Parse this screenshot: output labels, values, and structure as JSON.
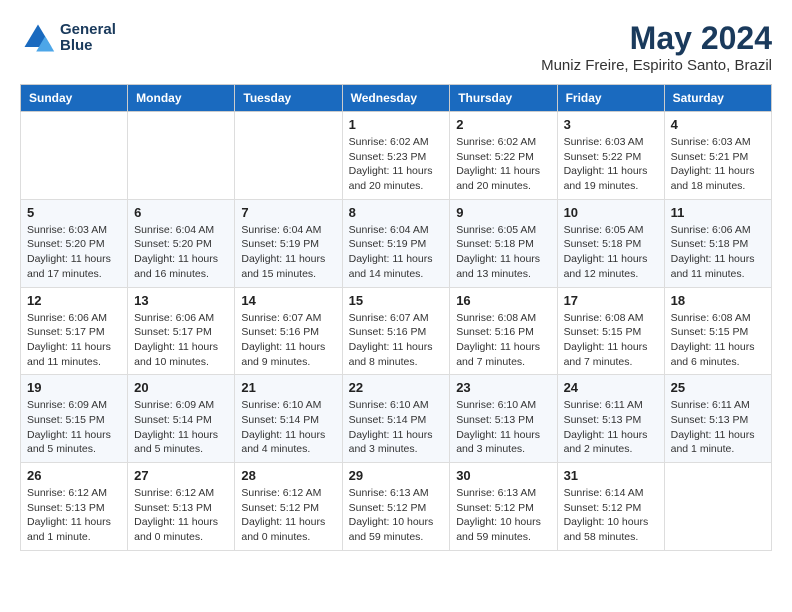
{
  "header": {
    "logo_line1": "General",
    "logo_line2": "Blue",
    "title": "May 2024",
    "subtitle": "Muniz Freire, Espirito Santo, Brazil"
  },
  "days_of_week": [
    "Sunday",
    "Monday",
    "Tuesday",
    "Wednesday",
    "Thursday",
    "Friday",
    "Saturday"
  ],
  "weeks": [
    [
      {
        "day": "",
        "sunrise": "",
        "sunset": "",
        "daylight": ""
      },
      {
        "day": "",
        "sunrise": "",
        "sunset": "",
        "daylight": ""
      },
      {
        "day": "",
        "sunrise": "",
        "sunset": "",
        "daylight": ""
      },
      {
        "day": "1",
        "sunrise": "Sunrise: 6:02 AM",
        "sunset": "Sunset: 5:23 PM",
        "daylight": "Daylight: 11 hours and 20 minutes."
      },
      {
        "day": "2",
        "sunrise": "Sunrise: 6:02 AM",
        "sunset": "Sunset: 5:22 PM",
        "daylight": "Daylight: 11 hours and 20 minutes."
      },
      {
        "day": "3",
        "sunrise": "Sunrise: 6:03 AM",
        "sunset": "Sunset: 5:22 PM",
        "daylight": "Daylight: 11 hours and 19 minutes."
      },
      {
        "day": "4",
        "sunrise": "Sunrise: 6:03 AM",
        "sunset": "Sunset: 5:21 PM",
        "daylight": "Daylight: 11 hours and 18 minutes."
      }
    ],
    [
      {
        "day": "5",
        "sunrise": "Sunrise: 6:03 AM",
        "sunset": "Sunset: 5:20 PM",
        "daylight": "Daylight: 11 hours and 17 minutes."
      },
      {
        "day": "6",
        "sunrise": "Sunrise: 6:04 AM",
        "sunset": "Sunset: 5:20 PM",
        "daylight": "Daylight: 11 hours and 16 minutes."
      },
      {
        "day": "7",
        "sunrise": "Sunrise: 6:04 AM",
        "sunset": "Sunset: 5:19 PM",
        "daylight": "Daylight: 11 hours and 15 minutes."
      },
      {
        "day": "8",
        "sunrise": "Sunrise: 6:04 AM",
        "sunset": "Sunset: 5:19 PM",
        "daylight": "Daylight: 11 hours and 14 minutes."
      },
      {
        "day": "9",
        "sunrise": "Sunrise: 6:05 AM",
        "sunset": "Sunset: 5:18 PM",
        "daylight": "Daylight: 11 hours and 13 minutes."
      },
      {
        "day": "10",
        "sunrise": "Sunrise: 6:05 AM",
        "sunset": "Sunset: 5:18 PM",
        "daylight": "Daylight: 11 hours and 12 minutes."
      },
      {
        "day": "11",
        "sunrise": "Sunrise: 6:06 AM",
        "sunset": "Sunset: 5:18 PM",
        "daylight": "Daylight: 11 hours and 11 minutes."
      }
    ],
    [
      {
        "day": "12",
        "sunrise": "Sunrise: 6:06 AM",
        "sunset": "Sunset: 5:17 PM",
        "daylight": "Daylight: 11 hours and 11 minutes."
      },
      {
        "day": "13",
        "sunrise": "Sunrise: 6:06 AM",
        "sunset": "Sunset: 5:17 PM",
        "daylight": "Daylight: 11 hours and 10 minutes."
      },
      {
        "day": "14",
        "sunrise": "Sunrise: 6:07 AM",
        "sunset": "Sunset: 5:16 PM",
        "daylight": "Daylight: 11 hours and 9 minutes."
      },
      {
        "day": "15",
        "sunrise": "Sunrise: 6:07 AM",
        "sunset": "Sunset: 5:16 PM",
        "daylight": "Daylight: 11 hours and 8 minutes."
      },
      {
        "day": "16",
        "sunrise": "Sunrise: 6:08 AM",
        "sunset": "Sunset: 5:16 PM",
        "daylight": "Daylight: 11 hours and 7 minutes."
      },
      {
        "day": "17",
        "sunrise": "Sunrise: 6:08 AM",
        "sunset": "Sunset: 5:15 PM",
        "daylight": "Daylight: 11 hours and 7 minutes."
      },
      {
        "day": "18",
        "sunrise": "Sunrise: 6:08 AM",
        "sunset": "Sunset: 5:15 PM",
        "daylight": "Daylight: 11 hours and 6 minutes."
      }
    ],
    [
      {
        "day": "19",
        "sunrise": "Sunrise: 6:09 AM",
        "sunset": "Sunset: 5:15 PM",
        "daylight": "Daylight: 11 hours and 5 minutes."
      },
      {
        "day": "20",
        "sunrise": "Sunrise: 6:09 AM",
        "sunset": "Sunset: 5:14 PM",
        "daylight": "Daylight: 11 hours and 5 minutes."
      },
      {
        "day": "21",
        "sunrise": "Sunrise: 6:10 AM",
        "sunset": "Sunset: 5:14 PM",
        "daylight": "Daylight: 11 hours and 4 minutes."
      },
      {
        "day": "22",
        "sunrise": "Sunrise: 6:10 AM",
        "sunset": "Sunset: 5:14 PM",
        "daylight": "Daylight: 11 hours and 3 minutes."
      },
      {
        "day": "23",
        "sunrise": "Sunrise: 6:10 AM",
        "sunset": "Sunset: 5:13 PM",
        "daylight": "Daylight: 11 hours and 3 minutes."
      },
      {
        "day": "24",
        "sunrise": "Sunrise: 6:11 AM",
        "sunset": "Sunset: 5:13 PM",
        "daylight": "Daylight: 11 hours and 2 minutes."
      },
      {
        "day": "25",
        "sunrise": "Sunrise: 6:11 AM",
        "sunset": "Sunset: 5:13 PM",
        "daylight": "Daylight: 11 hours and 1 minute."
      }
    ],
    [
      {
        "day": "26",
        "sunrise": "Sunrise: 6:12 AM",
        "sunset": "Sunset: 5:13 PM",
        "daylight": "Daylight: 11 hours and 1 minute."
      },
      {
        "day": "27",
        "sunrise": "Sunrise: 6:12 AM",
        "sunset": "Sunset: 5:13 PM",
        "daylight": "Daylight: 11 hours and 0 minutes."
      },
      {
        "day": "28",
        "sunrise": "Sunrise: 6:12 AM",
        "sunset": "Sunset: 5:12 PM",
        "daylight": "Daylight: 11 hours and 0 minutes."
      },
      {
        "day": "29",
        "sunrise": "Sunrise: 6:13 AM",
        "sunset": "Sunset: 5:12 PM",
        "daylight": "Daylight: 10 hours and 59 minutes."
      },
      {
        "day": "30",
        "sunrise": "Sunrise: 6:13 AM",
        "sunset": "Sunset: 5:12 PM",
        "daylight": "Daylight: 10 hours and 59 minutes."
      },
      {
        "day": "31",
        "sunrise": "Sunrise: 6:14 AM",
        "sunset": "Sunset: 5:12 PM",
        "daylight": "Daylight: 10 hours and 58 minutes."
      },
      {
        "day": "",
        "sunrise": "",
        "sunset": "",
        "daylight": ""
      }
    ]
  ]
}
